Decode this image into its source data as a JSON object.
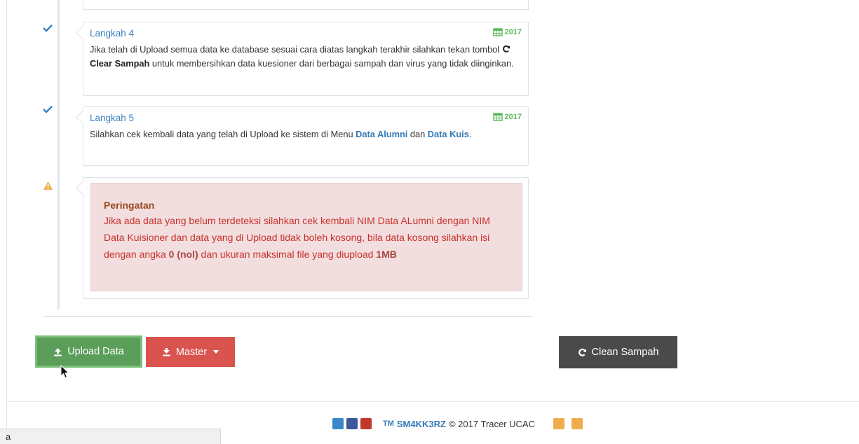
{
  "timeline": {
    "step4": {
      "title": "Langkah 4",
      "year": "2017",
      "text_before": "Jika telah di Upload semua data ke database sesuai cara diatas langkah terakhir silahkan tekan tombol ",
      "bold_button": "Clear Sampah",
      "text_after": " untuk membersihkan data kuesioner dari berbagai sampah dan virus yang tidak diinginkan."
    },
    "step5": {
      "title": "Langkah 5",
      "year": "2017",
      "text_before": "Silahkan cek kembali data yang telah di Upload ke sistem di Menu ",
      "link1": "Data Alumni",
      "text_mid": " dan ",
      "link2": "Data Kuis",
      "text_after": "."
    },
    "warning": {
      "title": "Peringatan",
      "text1": "Jika ada data yang belum terdeteksi silahkan cek kembali NIM Data ALumni dengan NIM Data Kuisioner dan data yang di Upload tidak boleh kosong, bila data kosong silahkan isi dengan angka ",
      "bold1": "0 (nol)",
      "text2": " dan ukuran maksimal file yang diupload ",
      "bold2": "1MB"
    }
  },
  "buttons": {
    "upload": "Upload Data",
    "master": "Master",
    "clean": "Clean Sampah"
  },
  "footer": {
    "tm": "TM",
    "brand": "SM4KK3RZ",
    "copyright": "© 2017 Tracer UCAC"
  },
  "status_bar": "a",
  "colors": {
    "link": "#337ab7",
    "success": "#5cb85c",
    "danger": "#d9534f",
    "dark": "#4a4a4a",
    "warning_icon": "#f0ad4e"
  },
  "icons": {
    "check": "check-icon",
    "warning": "warning-triangle-icon",
    "calendar": "calendar-icon",
    "refresh": "refresh-icon",
    "upload": "upload-icon",
    "download": "download-icon"
  }
}
